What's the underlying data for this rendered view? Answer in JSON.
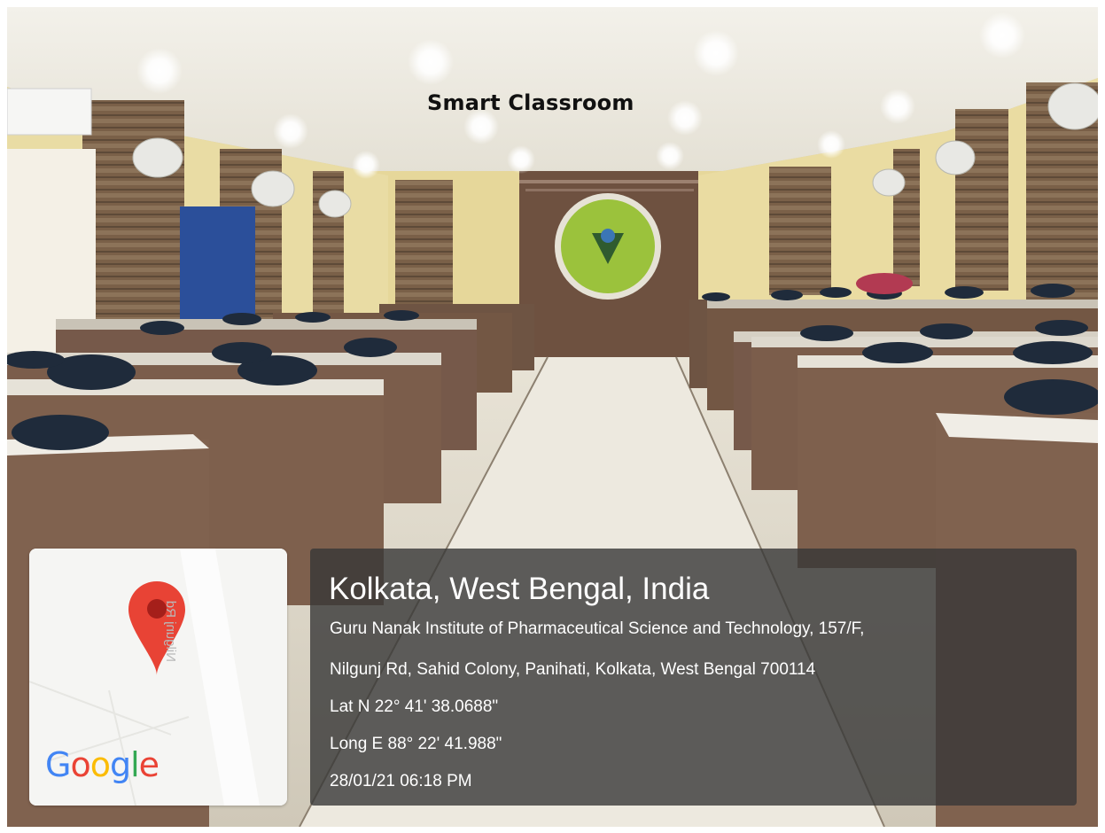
{
  "photo": {
    "title": "Smart Classroom"
  },
  "map_card": {
    "road_label": "Nilgunj Rd",
    "brand": [
      "G",
      "o",
      "o",
      "g",
      "l",
      "e"
    ],
    "brand_colors": [
      "#4285F4",
      "#EA4335",
      "#FBBC05",
      "#4285F4",
      "#34A853",
      "#EA4335"
    ],
    "pin_color": "#E84335",
    "icon": "map-pin-icon"
  },
  "location": {
    "city": "Kolkata, West Bengal, India",
    "address_line1": "Guru Nanak Institute of Pharmaceutical Science and Technology, 157/F,",
    "address_line2": "Nilgunj Rd, Sahid Colony, Panihati, Kolkata, West Bengal 700114",
    "latitude": "Lat N 22° 41' 38.0688\"",
    "longitude": "Long E 88° 22' 41.988\"",
    "datetime": "28/01/21 06:18 PM"
  }
}
